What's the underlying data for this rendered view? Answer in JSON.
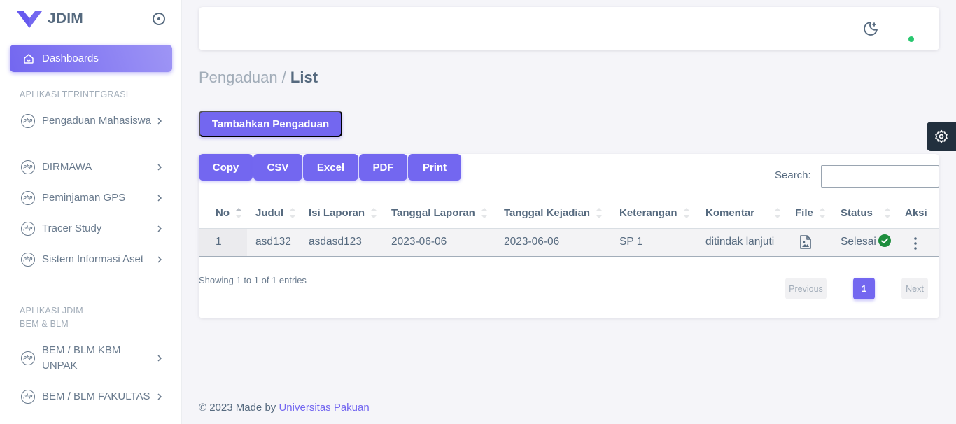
{
  "brand": {
    "name": "JDIM",
    "logo_color": "#7367f0"
  },
  "sidebar": {
    "active_item": {
      "label": "Dashboards",
      "icon": "home-icon"
    },
    "section_1_header": "APLIKASI TERINTEGRASI",
    "items": [
      {
        "label": "Pengaduan Mahasiswa",
        "icon": "php-icon"
      },
      {
        "label": "DIRMAWA",
        "icon": "php-icon"
      },
      {
        "label": "Peminjaman GPS",
        "icon": "php-icon"
      },
      {
        "label": "Tracer Study",
        "icon": "php-icon"
      },
      {
        "label": "Sistem Informasi Aset",
        "icon": "php-icon"
      }
    ],
    "section_2_header": "APLIKASI JDIM BEM & BLM",
    "items_2": [
      {
        "label": "BEM / BLM KBM UNPAK",
        "icon": "php-icon"
      },
      {
        "label": "BEM / BLM FAKULTAS",
        "icon": "php-icon"
      }
    ],
    "php_icon_text": "php"
  },
  "navbar": {
    "theme_icon": "moon-icon",
    "status_color": "#28c76f"
  },
  "page": {
    "breadcrumb_parent": "Pengaduan /",
    "breadcrumb_current": "List",
    "add_button": "Tambahkan Pengaduan"
  },
  "table": {
    "export_buttons": [
      "Copy",
      "CSV",
      "Excel",
      "PDF",
      "Print"
    ],
    "search_label": "Search:",
    "search_value": "",
    "columns": [
      "No",
      "Judul",
      "Isi Laporan",
      "Tanggal Laporan",
      "Tanggal Kejadian",
      "Keterangan",
      "Komentar",
      "File",
      "Status",
      "Aksi"
    ],
    "rows": [
      {
        "no": "1",
        "judul": "asd132",
        "isi_laporan": "asdasd123",
        "tanggal_laporan": "2023-06-06",
        "tanggal_kejadian": "2023-06-06",
        "keterangan": "SP 1",
        "komentar": "ditindak lanjuti",
        "file_icon": "image-file-icon",
        "status": "Selesai",
        "status_icon": "check-circle-icon",
        "aksi_icon": "more-vertical-icon"
      }
    ],
    "info": "Showing 1 to 1 of 1 entries",
    "pagination": {
      "previous": "Previous",
      "current": "1",
      "next": "Next"
    }
  },
  "footer": {
    "text": "© 2023 Made by",
    "link": "Universitas Pakuan"
  },
  "customizer_icon": "gear-icon",
  "colors": {
    "primary": "#7367f0",
    "success": "#28c76f",
    "dark": "#22303e"
  }
}
